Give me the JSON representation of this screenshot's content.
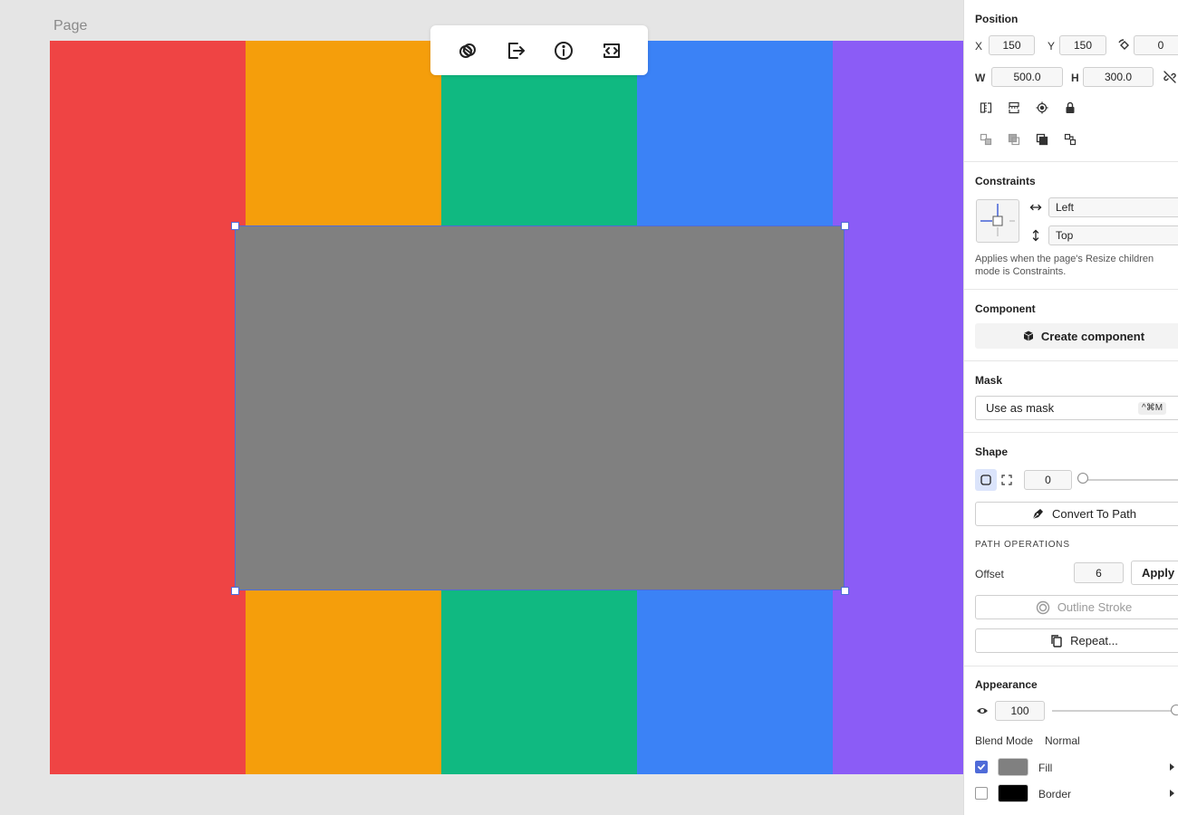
{
  "canvas": {
    "page_label": "Page",
    "stripe_colors": [
      "#ef4444",
      "#f59e0b",
      "#10b981",
      "#3b82f6",
      "#8b5cf6"
    ],
    "selected_fill": "#808080",
    "selection_color": "#4f6bd8"
  },
  "toolbar": {
    "items": [
      {
        "icon": "boolean-overlap-icon"
      },
      {
        "icon": "export-icon"
      },
      {
        "icon": "info-icon"
      },
      {
        "icon": "code-icon"
      }
    ]
  },
  "panel": {
    "position": {
      "title": "Position",
      "x_label": "X",
      "x_value": "150",
      "y_label": "Y",
      "y_value": "150",
      "rotation_value": "0",
      "w_label": "W",
      "w_value": "500.0",
      "h_label": "H",
      "h_value": "300.0"
    },
    "constraints": {
      "title": "Constraints",
      "horizontal": "Left",
      "vertical": "Top",
      "note": "Applies when the page's Resize children mode is Constraints."
    },
    "component": {
      "title": "Component",
      "create_label": "Create component"
    },
    "mask": {
      "title": "Mask",
      "use_label": "Use as mask",
      "shortcut": "^⌘M"
    },
    "shape": {
      "title": "Shape",
      "radius_value": "0",
      "convert_label": "Convert To Path",
      "path_ops_title": "PATH OPERATIONS",
      "offset_label": "Offset",
      "offset_value": "6",
      "apply_label": "Apply",
      "outline_label": "Outline Stroke",
      "repeat_label": "Repeat..."
    },
    "appearance": {
      "title": "Appearance",
      "opacity_value": "100",
      "blend_label": "Blend Mode",
      "blend_value": "Normal",
      "fill_label": "Fill",
      "fill_color": "#808080",
      "border_label": "Border",
      "border_color": "#000000"
    }
  }
}
